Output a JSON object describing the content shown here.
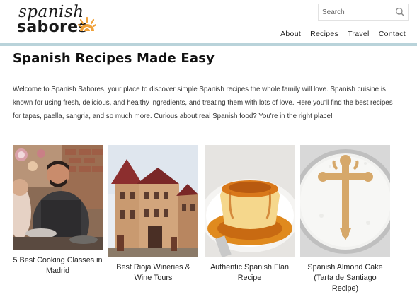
{
  "logo": {
    "line1": "spanish",
    "line2": "sabores"
  },
  "search": {
    "placeholder": "Search"
  },
  "nav": {
    "items": [
      "About",
      "Recipes",
      "Travel",
      "Contact"
    ]
  },
  "page": {
    "title": "Spanish Recipes Made Easy",
    "intro": "Welcome to Spanish Sabores, your place to discover simple Spanish recipes the whole family will love. Spanish cuisine is known for using fresh, delicious, and healthy ingredients, and treating them with lots of love. Here you'll find the best recipes for tapas, paella, sangria, and so much more. Curious about real Spanish food? You're in the right place!"
  },
  "cards": [
    {
      "caption": "5 Best Cooking Classes in Madrid",
      "image": "cooking-class-photo"
    },
    {
      "caption": "Best Rioja Wineries & Wine Tours",
      "image": "rioja-winery-photo"
    },
    {
      "caption": "Authentic Spanish Flan Recipe",
      "image": "flan-photo"
    },
    {
      "caption": "Spanish Almond Cake (Tarta de Santiago Recipe)",
      "image": "almond-cake-photo"
    }
  ],
  "colors": {
    "accent_orange": "#f0a13a",
    "divider": "#b9d3da",
    "text": "#222222"
  },
  "icons": {
    "search": "search-icon",
    "logo_sun": "sun-icon"
  }
}
